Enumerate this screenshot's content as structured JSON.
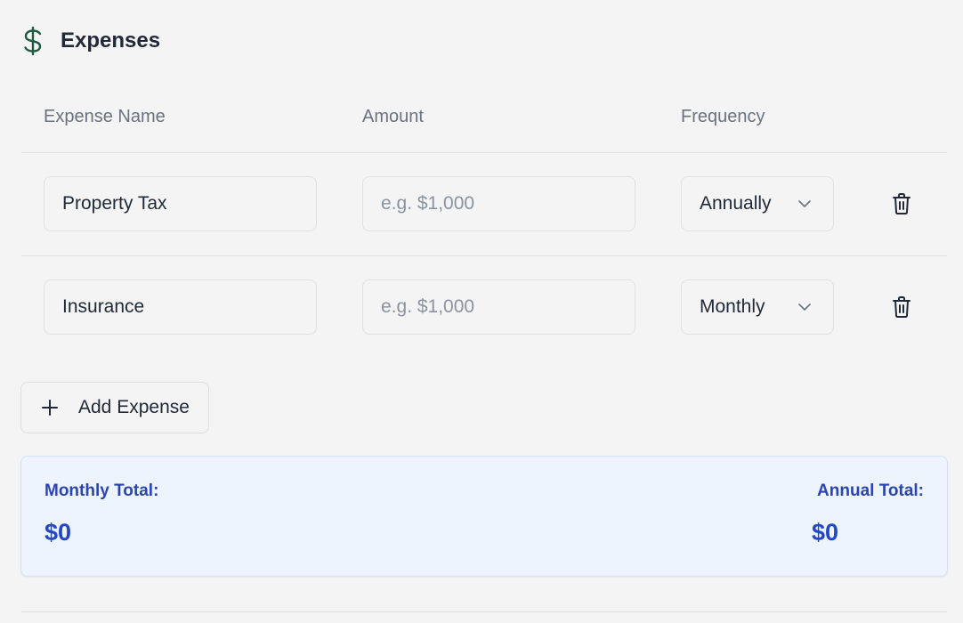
{
  "header": {
    "title": "Expenses",
    "icon": "dollar-icon"
  },
  "columns": {
    "name": "Expense Name",
    "amount": "Amount",
    "frequency": "Frequency"
  },
  "rows": [
    {
      "name": "Property Tax",
      "amount_value": "",
      "amount_placeholder": "e.g. $1,000",
      "frequency": "Annually"
    },
    {
      "name": "Insurance",
      "amount_value": "",
      "amount_placeholder": "e.g. $1,000",
      "frequency": "Monthly"
    }
  ],
  "add_button": {
    "label": "Add Expense"
  },
  "totals": {
    "monthly_label": "Monthly Total:",
    "monthly_value": "$0",
    "annual_label": "Annual Total:",
    "annual_value": "$0"
  },
  "colors": {
    "background": "#f4f4f4",
    "icon_green": "#1f5a3f",
    "totals_bg": "#eef4fd",
    "totals_text": "#2346c4",
    "muted_text": "#6b7280"
  }
}
